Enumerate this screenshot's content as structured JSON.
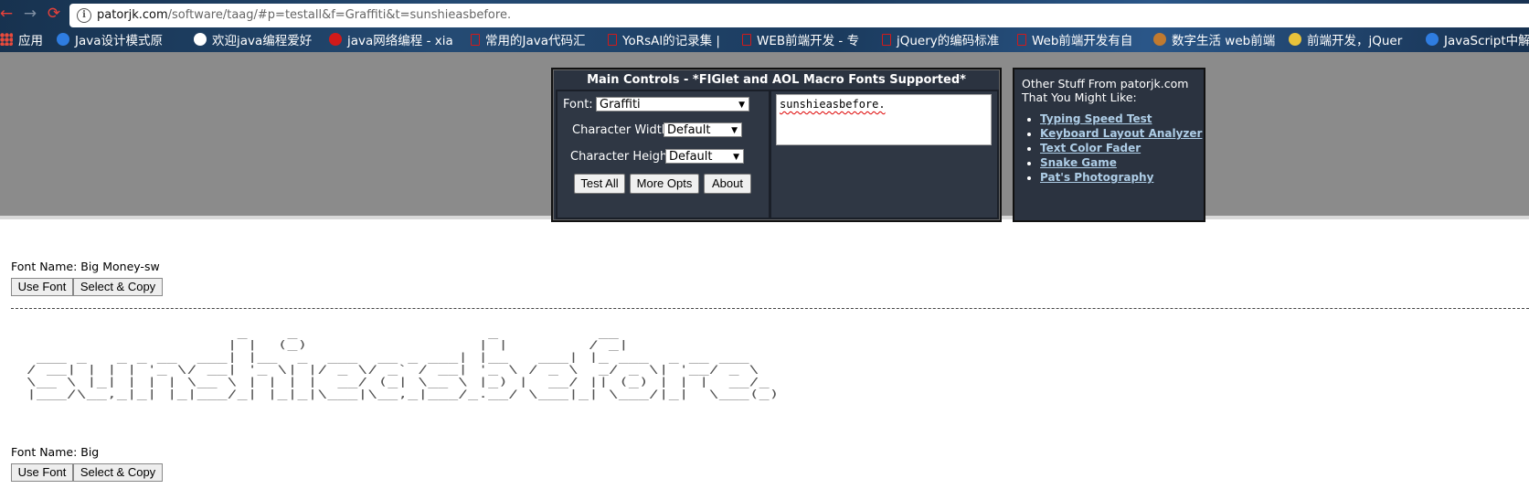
{
  "browser": {
    "url_host": "patorjk.com",
    "url_path": "/software/taag/#p=testall&f=Graffiti&t=sunshieasbefore.",
    "bookmarks": [
      {
        "label": "应用",
        "color": "#e84a3c"
      },
      {
        "label": "Java设计模式原",
        "color": "#2f7de1"
      },
      {
        "label": "欢迎java编程爱好",
        "color": "#ffffff"
      },
      {
        "label": "java网络编程 - xia",
        "color": "#d11a1a"
      },
      {
        "label": "常用的Java代码汇",
        "color": "#d11a1a"
      },
      {
        "label": "YoRsAl的记录集 |",
        "color": "#d11a1a"
      },
      {
        "label": "WEB前端开发 - 专",
        "color": "#d11a1a"
      },
      {
        "label": "jQuery的编码标准",
        "color": "#d11a1a"
      },
      {
        "label": "Web前端开发有自",
        "color": "#d11a1a"
      },
      {
        "label": "数字生活 web前端",
        "color": "#c07a30"
      },
      {
        "label": "前端开发，jQuer",
        "color": "#e8c23a"
      },
      {
        "label": "JavaScript中解",
        "color": "#2f7de1"
      }
    ]
  },
  "controls": {
    "title": "Main Controls - *FIGlet and AOL Macro Fonts Supported*",
    "font_label": "Font:",
    "font_value": "Graffiti",
    "char_width_label": "Character Width:",
    "char_width_value": "Default",
    "char_height_label": "Character Height:",
    "char_height_value": "Default",
    "test_all": "Test All",
    "more_opts": "More Opts",
    "about": "About",
    "text_value": "sunshieasbefore."
  },
  "other_stuff": {
    "intro": "Other Stuff From patorjk.com That You Might Like:",
    "links": [
      "Typing Speed Test",
      "Keyboard Layout Analyzer",
      "Text Color Fader",
      "Snake Game",
      "Pat's Photography"
    ]
  },
  "results": [
    {
      "font_name": "Font Name: Big Money-sw",
      "use_font": "Use Font",
      "select_copy": "Select & Copy"
    },
    {
      "font_name": "Font Name: Big",
      "use_font": "Use Font",
      "select_copy": "Select & Copy"
    }
  ],
  "ascii_art": "                      _    _                   _          __                 \n                     | |  (_)                 | |        / _|                \n  ___ _   _ _ __  ___| |__  _  ___  __ _ ___| |__   ___| |_ ___  _ __ ___  \n / __| | | | '_ \\/ __| '_ \\| |/ _ \\/ _` / __| '_ \\ / _ \\  _/ _ \\| '__/ _ \\ \n \\__ \\ |_| | | | \\__ \\ | | | |  __/ (_| \\__ \\ |_) |  __/ || (_) | | |  __/_\n |___/\\__,_|_| |_|___/_| |_|_|\\___|\\__,_|___/_.__/ \\___|_| \\___/|_|  \\___(_)"
}
